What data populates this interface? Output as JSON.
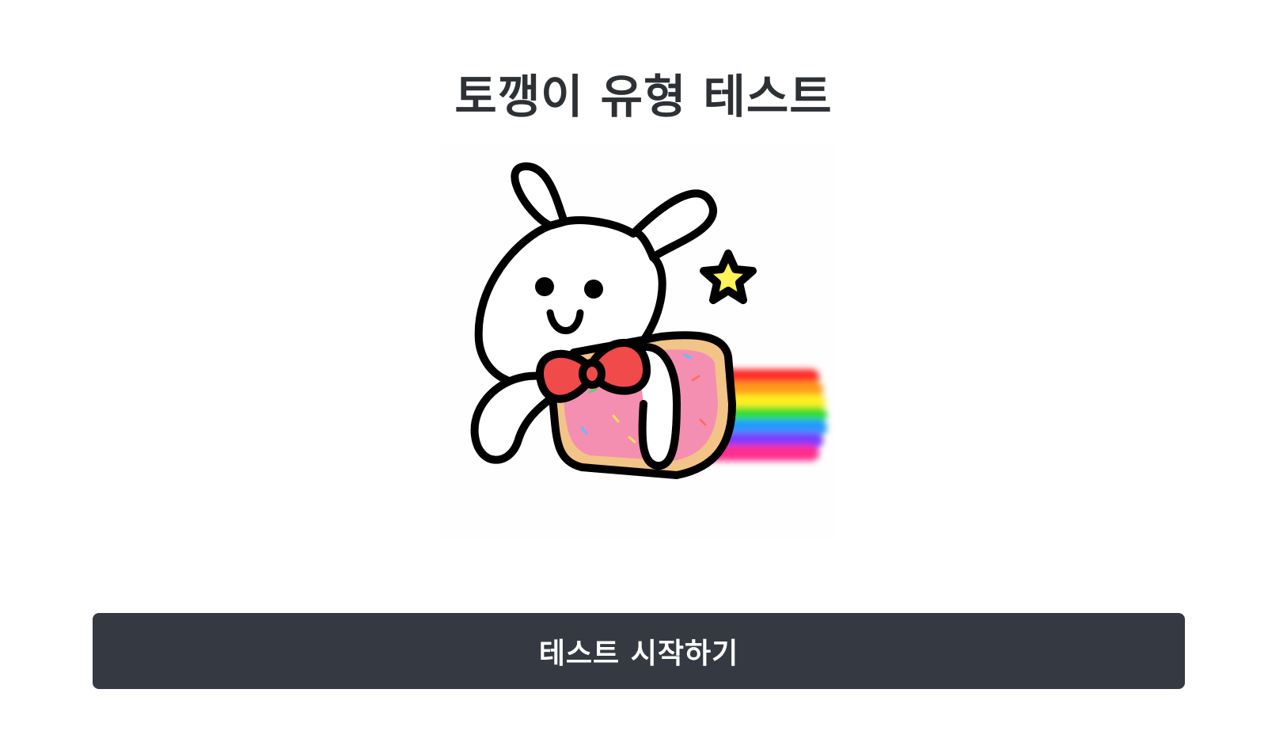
{
  "page": {
    "title": "토깽이 유형 테스트"
  },
  "hero": {
    "illustration": "bunny-on-rainbow-poptart"
  },
  "actions": {
    "start_label": "테스트 시작하기"
  },
  "colors": {
    "button_bg": "#353a42",
    "title_text": "#2d3136",
    "bow": "#f04a4a",
    "frosting": "#f48fb1",
    "crust": "#f2c488",
    "star": "#fff35a"
  }
}
